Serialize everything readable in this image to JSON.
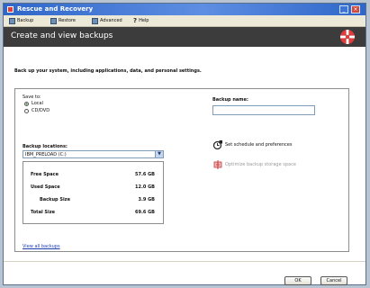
{
  "window": {
    "title": "Rescue and Recovery"
  },
  "menu": {
    "items": [
      {
        "label": "Backup",
        "icon": "backup-icon"
      },
      {
        "label": "Restore",
        "icon": "restore-icon"
      },
      {
        "label": "Advanced",
        "icon": "advanced-icon"
      },
      {
        "label": "Help",
        "icon": "help-icon"
      }
    ]
  },
  "header": {
    "title": "Create and view backups",
    "logo_color": "#e23b3b"
  },
  "instructions": "Back up your system, including applications, data, and personal settings.",
  "save_to": {
    "label": "Save to:",
    "options": [
      {
        "label": "Local",
        "checked": true
      },
      {
        "label": "CD/DVD",
        "checked": false
      }
    ]
  },
  "backup_name": {
    "label": "Backup name:",
    "value": ""
  },
  "backup_locations": {
    "label": "Backup locations:",
    "selected": "IBM_PRELOAD (C:)"
  },
  "stats": [
    {
      "label": "Free Space",
      "value": "57.6 GB"
    },
    {
      "label": "Used Space",
      "value": "12.0 GB"
    },
    {
      "label": "Backup Size",
      "value": "3.9 GB"
    },
    {
      "label": "Total Size",
      "value": "69.6 GB"
    }
  ],
  "links": {
    "view_all": "View all backups"
  },
  "actions": {
    "schedule": "Set schedule and preferences",
    "optimize": "Optimize backup storage space"
  },
  "buttons": {
    "ok": "OK",
    "cancel": "Cancel"
  }
}
